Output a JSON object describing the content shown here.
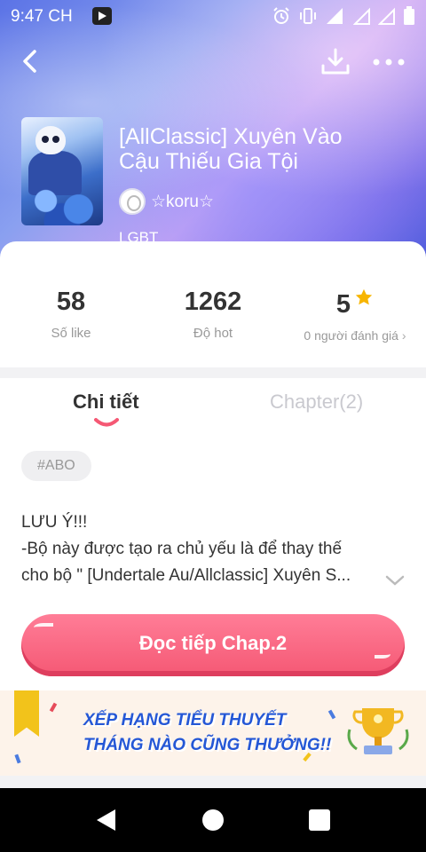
{
  "status_bar": {
    "time": "9:47 CH"
  },
  "header": {
    "title": "[AllClassic] Xuyên Vào Cậu Thiếu Gia Tội",
    "author": "☆koru☆",
    "genre": "LGBT"
  },
  "stats": {
    "likes": {
      "value": "58",
      "label": "Số like"
    },
    "hot": {
      "value": "1262",
      "label": "Độ hot"
    },
    "rating": {
      "value": "5",
      "label": "0 người đánh giá"
    }
  },
  "tabs": [
    {
      "label": "Chi tiết",
      "active": true
    },
    {
      "label": "Chapter(2)",
      "active": false
    }
  ],
  "tag": "#ABO",
  "description": [
    "LƯU Ý!!!",
    "-Bộ này được tạo ra chủ yếu là để thay thế",
    "cho bộ \" [Undertale Au/Allclassic] Xuyên S..."
  ],
  "read_button": "Đọc tiếp Chap.2",
  "banner": {
    "line1": "XẾP HẠNG TIỂU THUYẾT",
    "line2": "THÁNG NÀO CŨNG THƯỞNG!!"
  },
  "colors": {
    "accent": "#f55874",
    "star": "#f7b500",
    "banner_text": "#2457d6"
  },
  "icons": [
    "back-icon",
    "download-icon",
    "more-icon",
    "star-icon",
    "chevron-right-icon",
    "chevron-down-icon",
    "trophy-icon",
    "nav-back-icon",
    "nav-home-icon",
    "nav-recent-icon"
  ]
}
